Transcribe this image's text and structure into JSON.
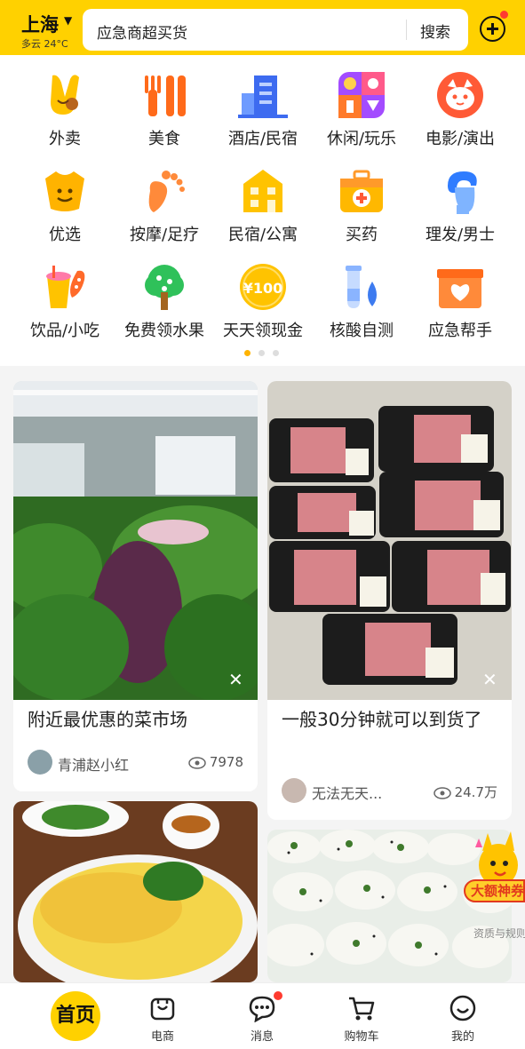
{
  "header": {
    "city": "上海",
    "weather": "多云 24°C",
    "search_text": "应急商超买货",
    "search_button": "搜索"
  },
  "categories": [
    {
      "label": "外卖",
      "icon": "takeout-icon"
    },
    {
      "label": "美食",
      "icon": "food-icon"
    },
    {
      "label": "酒店/民宿",
      "icon": "hotel-icon"
    },
    {
      "label": "休闲/玩乐",
      "icon": "leisure-icon"
    },
    {
      "label": "电影/演出",
      "icon": "movie-icon"
    },
    {
      "label": "优选",
      "icon": "youxuan-icon"
    },
    {
      "label": "按摩/足疗",
      "icon": "foot-massage-icon"
    },
    {
      "label": "民宿/公寓",
      "icon": "apartment-icon"
    },
    {
      "label": "买药",
      "icon": "medicine-icon"
    },
    {
      "label": "理发/男士",
      "icon": "haircut-icon"
    },
    {
      "label": "饮品/小吃",
      "icon": "drinks-icon"
    },
    {
      "label": "免费领水果",
      "icon": "fruit-tree-icon"
    },
    {
      "label": "天天领现金",
      "icon": "cash-coin-icon"
    },
    {
      "label": "核酸自测",
      "icon": "test-tube-icon"
    },
    {
      "label": "应急帮手",
      "icon": "emergency-box-icon"
    }
  ],
  "cash_coin_text": "¥100",
  "feed": [
    {
      "title": "附近最优惠的菜市场",
      "author": "青浦赵小红",
      "views": "7978"
    },
    {
      "title": "一般30分钟就可以到货了",
      "author": "无法无天...",
      "views": "24.7万"
    }
  ],
  "promo": {
    "badge": "大额神券",
    "note": "资质与规则"
  },
  "tabs": [
    {
      "label": "首页"
    },
    {
      "label": "电商"
    },
    {
      "label": "消息"
    },
    {
      "label": "购物车"
    },
    {
      "label": "我的"
    }
  ],
  "colors": {
    "brand_yellow": "#ffd100",
    "badge_red": "#ff3b30"
  }
}
